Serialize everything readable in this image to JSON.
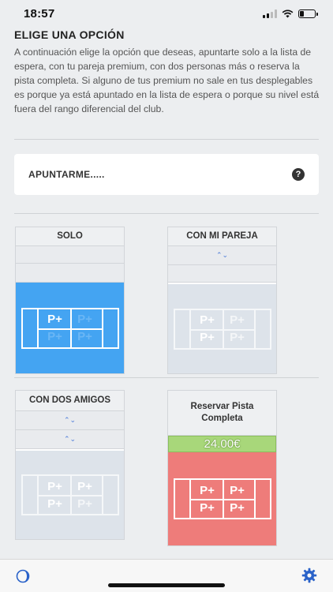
{
  "status": {
    "time": "18:57"
  },
  "page": {
    "title": "ELIGE UNA OPCIÓN",
    "intro": "A continuación elige la opción que deseas, apuntarte solo a la lista de espera, con tu pareja premium, con dos personas más o reserva la pista completa. Si alguno de tus premium no sale en tus desplegables es porque ya está apuntado en la lista de espera o porque su nivel está fuera del rango diferencial del club."
  },
  "apuntarme": {
    "label": "APUNTARME.....",
    "help": "?"
  },
  "court_label": "P+",
  "options": {
    "solo": {
      "title": "SOLO"
    },
    "pareja": {
      "title": "CON MI PAREJA",
      "stepper": "⌃⌄"
    },
    "amigos": {
      "title": "CON DOS AMIGOS",
      "stepper1": "⌃⌄",
      "stepper2": "⌃⌄"
    },
    "pista": {
      "title": "Reservar Pista Completa",
      "price": "24.00€"
    }
  },
  "colors": {
    "solo": "#44a4f2",
    "pista": "#ee7c7a",
    "price": "#a8d77a",
    "accent": "#2a62c9"
  },
  "icons": {
    "tab_left": "moon-icon",
    "tab_right": "gear-icon"
  }
}
